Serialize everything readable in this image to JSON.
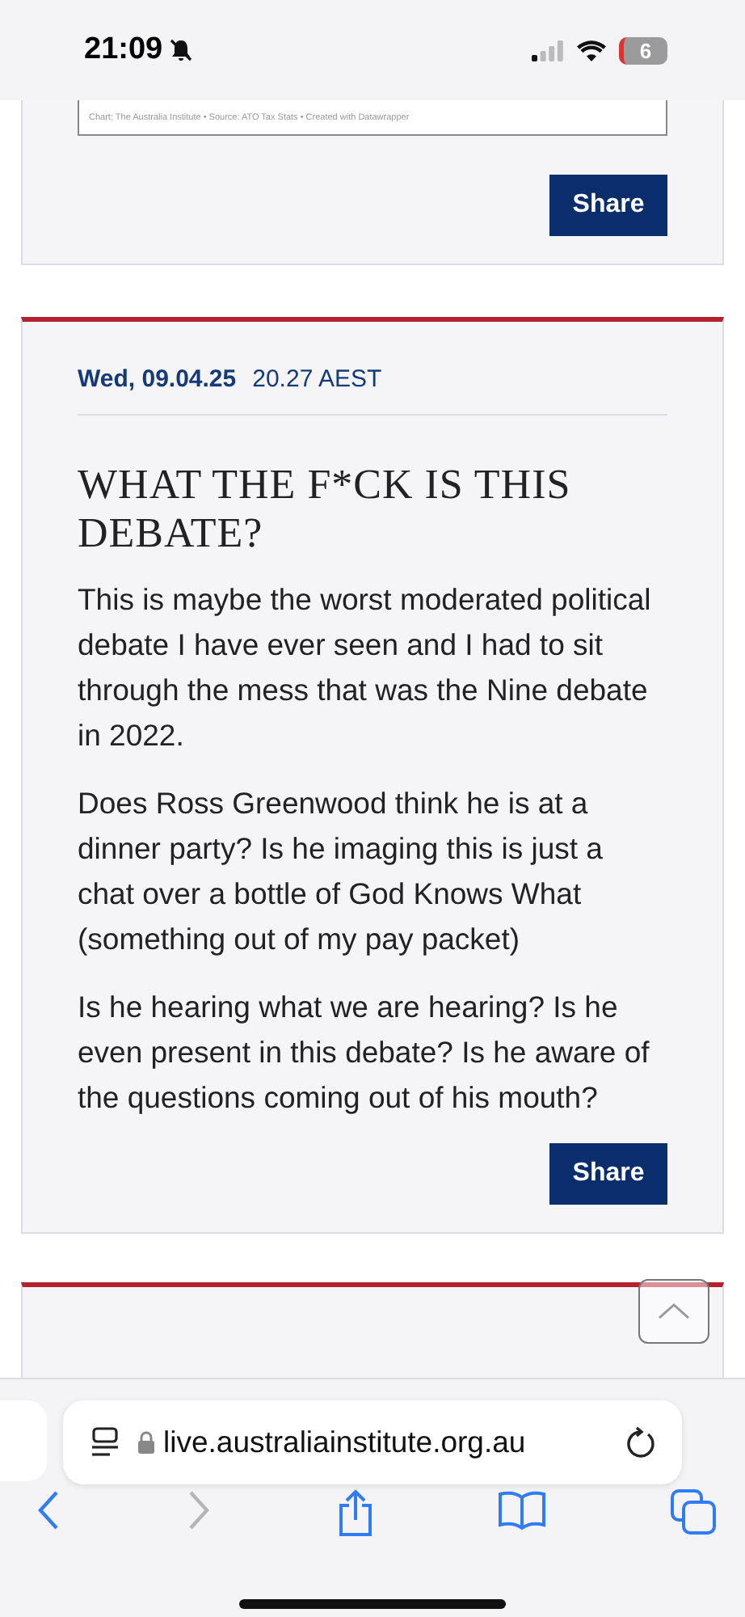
{
  "status_bar": {
    "time": "21:09",
    "silent": true,
    "battery": "6"
  },
  "posts": [
    {
      "chart_source": "Chart: The Australia Institute  • Source: ATO Tax Stats • Created with Datawrapper",
      "share": "Share"
    },
    {
      "date": "Wed, 09.04.25",
      "time": "20.27 AEST",
      "title": "WHAT THE F*CK IS THIS DEBATE?",
      "paragraphs": [
        "This is maybe the worst moderated political debate I have ever seen and I had to sit through the mess that was the Nine debate in 2022.",
        "Does Ross Greenwood think he is at a dinner party? Is he imaging this is just a chat over a bottle of God Knows What (something out of my pay packet)",
        "Is he hearing what we are hearing? Is he even present in this debate? Is he aware of the questions coming out of his mouth?"
      ],
      "share": "Share"
    }
  ],
  "browser": {
    "url": "live.australiainstitute.org.au",
    "forward_disabled": true
  }
}
